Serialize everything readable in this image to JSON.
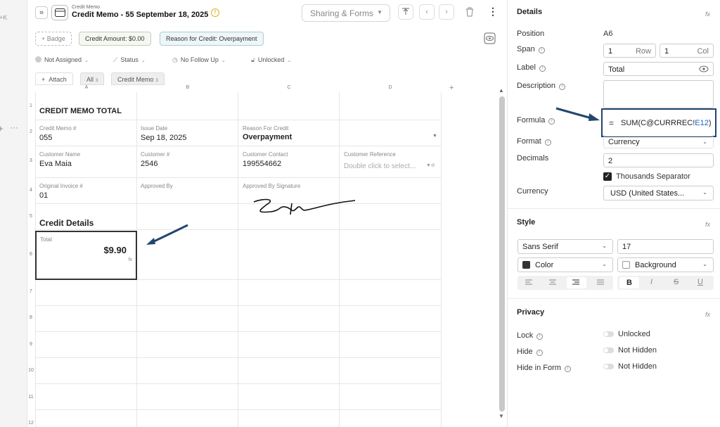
{
  "shortcut": "L+K",
  "header": {
    "subtitle": "Credit Memo",
    "title": "Credit Memo - 55 September 18, 2025",
    "share_label": "Sharing & Forms"
  },
  "tags": {
    "badge": "Badge",
    "amount": "Credit Amount: $0.00",
    "reason": "Reason for Credit: Overpayment"
  },
  "status_row": {
    "assigned": "Not Assigned",
    "status": "Status",
    "follow": "No Follow Up",
    "lock": "Unlocked"
  },
  "tabs": {
    "attach": "Attach",
    "all": "All",
    "all_count": "3",
    "memo": "Credit Memo",
    "memo_count": "3"
  },
  "grid": {
    "columns": [
      "A",
      "B",
      "C",
      "D"
    ],
    "rows": [
      "1",
      "2",
      "3",
      "4",
      "5",
      "6",
      "7",
      "8",
      "9",
      "10",
      "11",
      "12"
    ],
    "r1_title": "CREDIT MEMO TOTAL",
    "memo_no_label": "Credit Memo #",
    "memo_no": "055",
    "issue_label": "Issue Date",
    "issue": "Sep 18, 2025",
    "reason_label": "Reason For Credit",
    "reason": "Overpayment",
    "cust_name_label": "Customer Name",
    "cust_name": "Eva Maia",
    "cust_no_label": "Customer #",
    "cust_no": "2546",
    "contact_label": "Customer Contact",
    "contact": "199554662",
    "ref_label": "Customer Reference",
    "ref_placeholder": "Double click to select...",
    "invoice_label": "Original Invoice #",
    "invoice": "01",
    "approved_label": "Approved By",
    "signature_label": "Approved By Signature",
    "section": "Credit Details",
    "total_label": "Total",
    "total": "$9.90"
  },
  "panel": {
    "details": "Details",
    "position_label": "Position",
    "position": "A6",
    "span_label": "Span",
    "span_row": "1",
    "row_label": "Row",
    "span_col": "1",
    "col_label": "Col",
    "label_label": "Label",
    "label_value": "Total",
    "description_label": "Description",
    "formula_label": "Formula",
    "formula_prefix": "SUM(C@CURRREC!",
    "formula_ref": "E12",
    "formula_suffix": ")",
    "format_label": "Format",
    "format": "Currency",
    "decimals_label": "Decimals",
    "decimals": "2",
    "thousands": "Thousands Separator",
    "currency_label": "Currency",
    "currency": "USD (United States...",
    "style": "Style",
    "font": "Sans Serif",
    "font_size": "17",
    "color": "Color",
    "background": "Background",
    "privacy": "Privacy",
    "lock_label": "Lock",
    "lock": "Unlocked",
    "hide_label": "Hide",
    "hide": "Not Hidden",
    "hide_form_label": "Hide in Form",
    "hide_form": "Not Hidden"
  }
}
